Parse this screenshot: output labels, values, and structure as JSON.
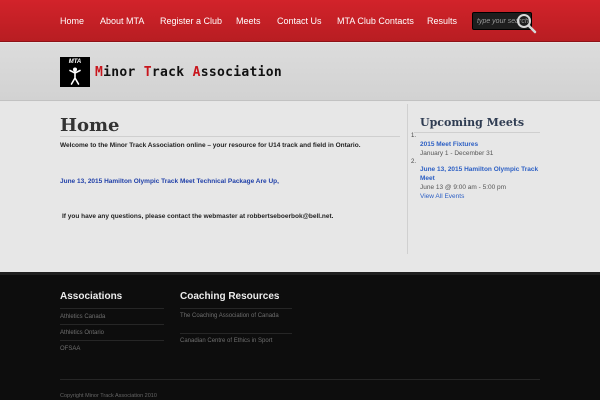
{
  "nav": {
    "items": [
      "Home",
      "About MTA",
      "Register a Club",
      "Meets",
      "Contact Us",
      "MTA Club Contacts",
      "Results"
    ],
    "search_placeholder": "type your search"
  },
  "header": {
    "badge_text": "MTA",
    "logo_parts": [
      "M",
      "inor ",
      "T",
      "rack ",
      "A",
      "ssociation"
    ]
  },
  "main": {
    "title": "Home",
    "paragraphs": [
      "Welcome to the Minor Track Association online – your resource for U14 track and field in Ontario.",
      "June 13, 2015 Hamilton Olympic Track Meet Technical Package  Are Up,",
      "If you have any questions, please contact the webmaster at robbertseboerbok@bell.net."
    ]
  },
  "sidebar": {
    "title": "Upcoming Meets",
    "events": [
      {
        "num": "1.",
        "name": "2015 Meet Fixtures",
        "date": "January 1 - December 31"
      },
      {
        "num": "2.",
        "name": "June 13, 2015 Hamilton Olympic Track Meet",
        "date": "June 13 @ 9:00 am - 5:00 pm"
      }
    ],
    "view_all": "View All Events"
  },
  "footer": {
    "columns": [
      {
        "title": "Associations",
        "links": [
          "Athletics Canada",
          "Athletics Ontario",
          "OFSAA"
        ]
      },
      {
        "title": "Coaching Resources",
        "links": [
          "The Coaching Association of Canada",
          "Canadian Centre of Ethics in Sport"
        ]
      }
    ],
    "copyright": "Copyright Minor Track Association 2010"
  },
  "colors": {
    "nav_red": "#d2232a",
    "logo_accent": "#c8161d",
    "link_blue": "#2c5fc4",
    "footer_bg": "#0d0d0d"
  },
  "icons": {
    "search": "magnifier-icon",
    "logo": "runner-icon"
  }
}
